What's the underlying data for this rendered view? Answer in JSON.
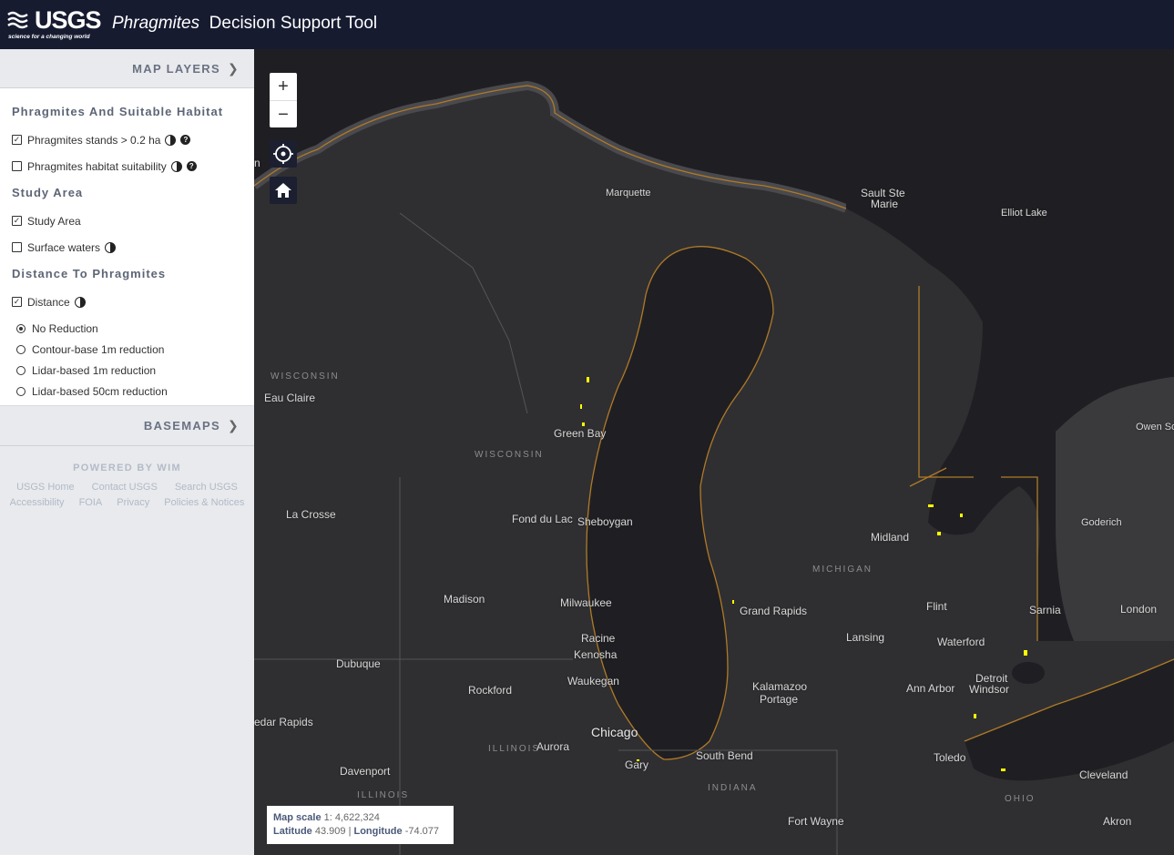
{
  "header": {
    "logo_text": "USGS",
    "logo_tagline": "science for a changing world",
    "title_italic": "Phragmites",
    "title_rest": "Decision Support Tool"
  },
  "sidebar": {
    "map_layers_label": "MAP LAYERS",
    "groups": [
      {
        "title": "Phragmites And Suitable Habitat",
        "items": [
          {
            "label": "Phragmites stands > 0.2 ha",
            "checked": true
          },
          {
            "label": "Phragmites habitat suitability",
            "checked": false
          }
        ]
      },
      {
        "title": "Study Area",
        "items": [
          {
            "label": "Study Area",
            "checked": true
          },
          {
            "label": "Surface waters",
            "checked": false
          }
        ]
      },
      {
        "title": "Distance To Phragmites",
        "items": [
          {
            "label": "Distance",
            "checked": true
          }
        ],
        "radios": [
          {
            "label": "No Reduction",
            "selected": true
          },
          {
            "label": "Contour-base 1m reduction",
            "selected": false
          },
          {
            "label": "Lidar-based 1m reduction",
            "selected": false
          },
          {
            "label": "Lidar-based 50cm reduction",
            "selected": false
          }
        ]
      }
    ],
    "basemaps_label": "BASEMAPS",
    "footer": {
      "powered_by": "POWERED BY WIM",
      "links_row1": [
        "USGS Home",
        "Contact USGS",
        "Search USGS"
      ],
      "links_row2": [
        "Accessibility",
        "FOIA",
        "Privacy",
        "Policies & Notices"
      ]
    }
  },
  "map": {
    "zoom_in": "+",
    "zoom_out": "−",
    "locate_icon": "crosshair-icon",
    "home_icon": "home-icon",
    "labels": [
      "Marquette",
      "Sault Ste",
      "Marie",
      "Elliot Lake",
      "WISCONSIN",
      "Eau Claire",
      "Green Bay",
      "WISCONSIN",
      "Owen So",
      "La Crosse",
      "Fond du Lac",
      "Sheboygan",
      "Midland",
      "Goderich",
      "MICHIGAN",
      "Madison",
      "Milwaukee",
      "Grand Rapids",
      "Flint",
      "Sarnia",
      "London",
      "Racine",
      "Kenosha",
      "Lansing",
      "Waterford",
      "Dubuque",
      "Waukegan",
      "Rockford",
      "Kalamazoo",
      "Portage",
      "Ann Arbor",
      "Detroit",
      "Windsor",
      "edar Rapids",
      "Chicago",
      "ILLINOIS",
      "Aurora",
      "South Bend",
      "Toledo",
      "Gary",
      "Davenport",
      "INDIANA",
      "Cleveland",
      "ILLINOIS",
      "OHIO",
      "Fort Wayne",
      "Akron",
      "n"
    ],
    "scale": {
      "scale_label": "Map scale",
      "scale_value": "1: 4,622,324",
      "lat_label": "Latitude",
      "lat_value": "43.909",
      "separator": "|",
      "lon_label": "Longitude",
      "lon_value": "-74.077"
    },
    "colors": {
      "water": "#1f1f23",
      "land": "#3a3a3d",
      "study_area_outline": "#b07a26",
      "phragmites": "#ffff00",
      "header": "#161b30"
    }
  }
}
